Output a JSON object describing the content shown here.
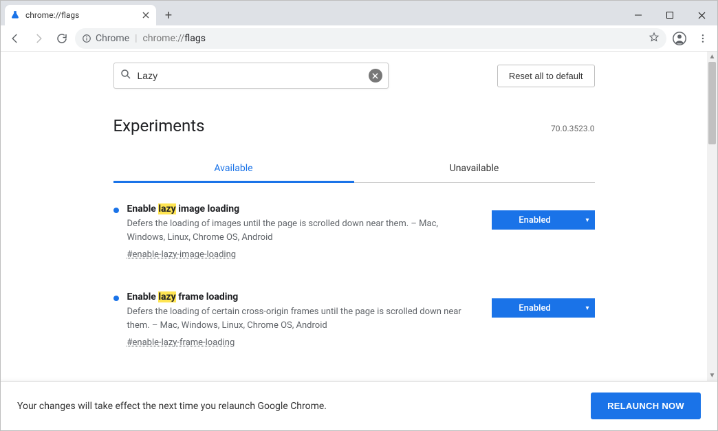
{
  "browser": {
    "tab_title": "chrome://flags",
    "omnibox_label": "Chrome",
    "omnibox_url_prefix": "chrome://",
    "omnibox_url_path": "flags"
  },
  "search": {
    "value": "Lazy"
  },
  "reset_button": "Reset all to default",
  "heading": "Experiments",
  "version": "70.0.3523.0",
  "tabs": {
    "available": "Available",
    "unavailable": "Unavailable"
  },
  "flags": [
    {
      "title_pre": "Enable ",
      "title_hl": "lazy",
      "title_post": " image loading",
      "description": "Defers the loading of images until the page is scrolled down near them. – Mac, Windows, Linux, Chrome OS, Android",
      "hash": "#enable-lazy-image-loading",
      "state": "Enabled"
    },
    {
      "title_pre": "Enable ",
      "title_hl": "lazy",
      "title_post": " frame loading",
      "description": "Defers the loading of certain cross-origin frames until the page is scrolled down near them. – Mac, Windows, Linux, Chrome OS, Android",
      "hash": "#enable-lazy-frame-loading",
      "state": "Enabled"
    }
  ],
  "bottombar": {
    "message": "Your changes will take effect the next time you relaunch Google Chrome.",
    "button": "RELAUNCH NOW"
  }
}
